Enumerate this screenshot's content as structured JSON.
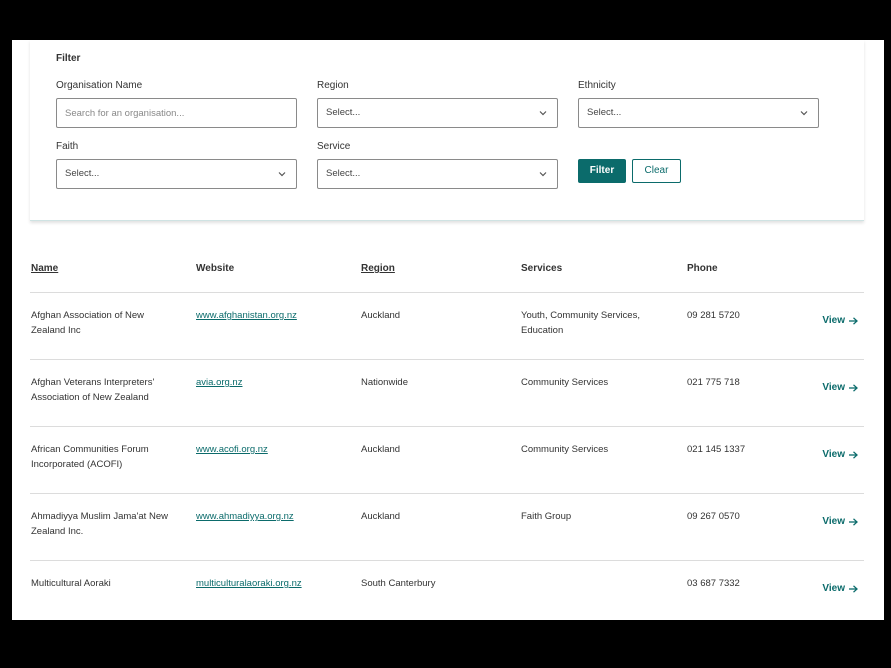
{
  "filter": {
    "title": "Filter",
    "org_label": "Organisation Name",
    "org_placeholder": "Search for an organisation...",
    "region_label": "Region",
    "region_value": "Select...",
    "ethnicity_label": "Ethnicity",
    "ethnicity_value": "Select...",
    "faith_label": "Faith",
    "faith_value": "Select...",
    "service_label": "Service",
    "service_value": "Select...",
    "filter_button": "Filter",
    "clear_button": "Clear"
  },
  "table": {
    "headers": {
      "name": "Name",
      "website": "Website",
      "region": "Region",
      "services": "Services",
      "phone": "Phone"
    },
    "view_label": "View",
    "rows": [
      {
        "name": "Afghan Association of New Zealand Inc",
        "website": "www.afghanistan.org.nz",
        "region": "Auckland",
        "services": "Youth, Community Services, Education",
        "phone": "09 281 5720"
      },
      {
        "name": "Afghan Veterans Interpreters' Association of New Zealand",
        "website": "avia.org.nz",
        "region": "Nationwide",
        "services": "Community Services",
        "phone": "021 775 718"
      },
      {
        "name": "African Communities Forum Incorporated (ACOFI)",
        "website": "www.acofi.org.nz",
        "region": "Auckland",
        "services": "Community Services",
        "phone": "021 145 1337"
      },
      {
        "name": "Ahmadiyya Muslim Jama'at New Zealand Inc.",
        "website": "www.ahmadiyya.org.nz",
        "region": "Auckland",
        "services": "Faith Group",
        "phone": "09 267 0570"
      },
      {
        "name": "Multicultural Aoraki",
        "website": "multiculturalaoraki.org.nz",
        "region": "South Canterbury",
        "services": "",
        "phone": "03 687 7332"
      }
    ]
  },
  "colors": {
    "accent": "#0b6b6b",
    "border": "#8a8a8a"
  },
  "icons": {
    "select_chevron": "chevron-down-icon",
    "view_arrow": "arrow-right-icon"
  }
}
